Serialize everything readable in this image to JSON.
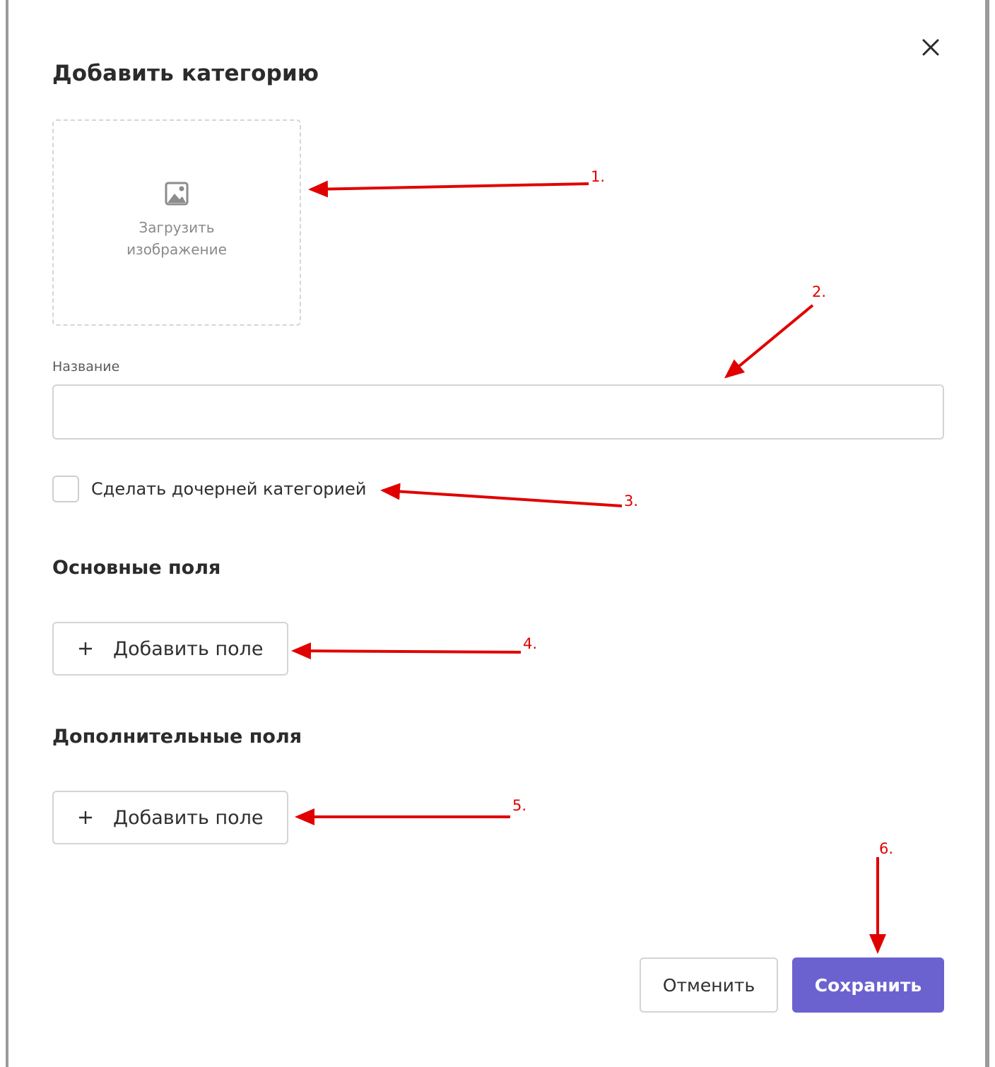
{
  "dialog": {
    "title": "Добавить категорию",
    "close_icon": "close-icon"
  },
  "upload": {
    "icon": "image-icon",
    "label_line1": "Загрузить",
    "label_line2": "изображение"
  },
  "name_field": {
    "label": "Название",
    "value": "",
    "placeholder": ""
  },
  "child_category": {
    "label": "Сделать дочерней категорией",
    "checked": false
  },
  "main_fields": {
    "heading": "Основные поля",
    "add_label": "Добавить поле"
  },
  "extra_fields": {
    "heading": "Дополнительные поля",
    "add_label": "Добавить поле"
  },
  "actions": {
    "cancel_label": "Отменить",
    "save_label": "Сохранить"
  },
  "annotations": {
    "a1": "1.",
    "a2": "2.",
    "a3": "3.",
    "a4": "4.",
    "a5": "5.",
    "a6": "6."
  },
  "colors": {
    "primary": "#6b62d0",
    "annotation": "#e00000",
    "border": "#d4d4d4"
  }
}
